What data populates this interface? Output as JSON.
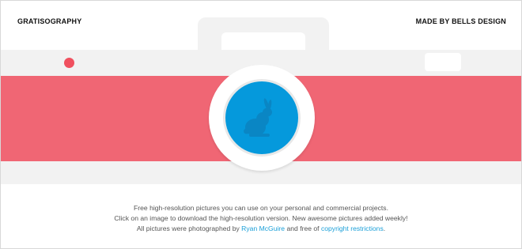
{
  "header": {
    "brand": "GRATISOGRAPHY",
    "credit": "MADE BY BELLS DESIGN"
  },
  "hero": {
    "icon": "camera-illustration",
    "lens_icon": "rabbit-icon",
    "colors": {
      "stripe": "#f06674",
      "lens": "#0599dc",
      "dot": "#f0505f",
      "body": "#f2f2f2"
    }
  },
  "info": {
    "line1": "Free high-resolution pictures you can use on your personal and commercial projects.",
    "line2": "Click on an image to download the high-resolution version. New awesome pictures added weekly!",
    "line3_prefix": "All pictures were photographed by ",
    "photographer": "Ryan McGuire",
    "line3_middle": " and free of ",
    "license_link": "copyright restrictions",
    "line3_suffix": "."
  }
}
